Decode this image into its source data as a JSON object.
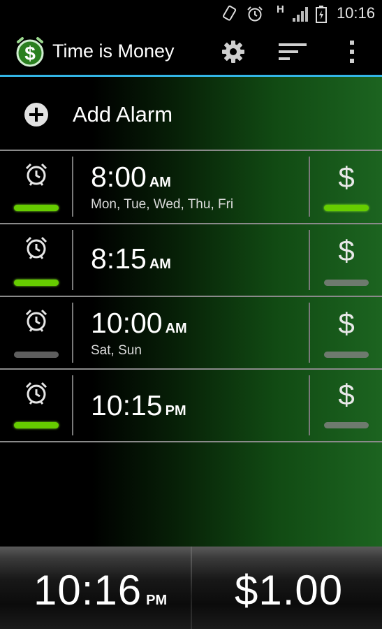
{
  "status_bar": {
    "network_label": "H",
    "time": "10:16"
  },
  "action_bar": {
    "title": "Time is Money",
    "icons": {
      "app": "dollar-app-icon",
      "settings": "gear-icon",
      "sort": "sort-icon",
      "overflow": "overflow-menu-icon"
    },
    "accent_color": "#33b5e5"
  },
  "add_alarm": {
    "label": "Add Alarm",
    "icon": "plus-circle-icon"
  },
  "alarms": [
    {
      "time": "8:00",
      "ampm": "AM",
      "days": "Mon, Tue, Wed, Thu, Fri",
      "alarm_enabled": true,
      "money_enabled": true
    },
    {
      "time": "8:15",
      "ampm": "AM",
      "days": "",
      "alarm_enabled": true,
      "money_enabled": false
    },
    {
      "time": "10:00",
      "ampm": "AM",
      "days": "Sat, Sun",
      "alarm_enabled": false,
      "money_enabled": false
    },
    {
      "time": "10:15",
      "ampm": "PM",
      "days": "",
      "alarm_enabled": true,
      "money_enabled": false
    }
  ],
  "row_symbol": "$",
  "bottom": {
    "current_time": "10:16",
    "current_ampm": "PM",
    "money": "$1.00"
  },
  "colors": {
    "enabled": "#66cc00",
    "disabled": "#5e5e5e",
    "gradient_end": "#1c6420"
  }
}
